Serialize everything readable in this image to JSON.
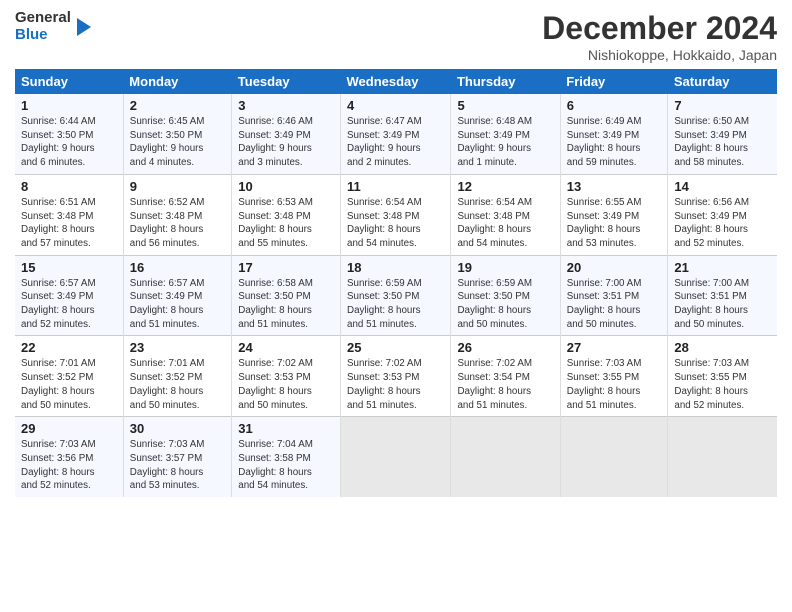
{
  "header": {
    "logo_general": "General",
    "logo_blue": "Blue",
    "title": "December 2024",
    "location": "Nishiokoppe, Hokkaido, Japan"
  },
  "weekdays": [
    "Sunday",
    "Monday",
    "Tuesday",
    "Wednesday",
    "Thursday",
    "Friday",
    "Saturday"
  ],
  "weeks": [
    [
      {
        "day": "1",
        "info": "Sunrise: 6:44 AM\nSunset: 3:50 PM\nDaylight: 9 hours\nand 6 minutes."
      },
      {
        "day": "2",
        "info": "Sunrise: 6:45 AM\nSunset: 3:50 PM\nDaylight: 9 hours\nand 4 minutes."
      },
      {
        "day": "3",
        "info": "Sunrise: 6:46 AM\nSunset: 3:49 PM\nDaylight: 9 hours\nand 3 minutes."
      },
      {
        "day": "4",
        "info": "Sunrise: 6:47 AM\nSunset: 3:49 PM\nDaylight: 9 hours\nand 2 minutes."
      },
      {
        "day": "5",
        "info": "Sunrise: 6:48 AM\nSunset: 3:49 PM\nDaylight: 9 hours\nand 1 minute."
      },
      {
        "day": "6",
        "info": "Sunrise: 6:49 AM\nSunset: 3:49 PM\nDaylight: 8 hours\nand 59 minutes."
      },
      {
        "day": "7",
        "info": "Sunrise: 6:50 AM\nSunset: 3:49 PM\nDaylight: 8 hours\nand 58 minutes."
      }
    ],
    [
      {
        "day": "8",
        "info": "Sunrise: 6:51 AM\nSunset: 3:48 PM\nDaylight: 8 hours\nand 57 minutes."
      },
      {
        "day": "9",
        "info": "Sunrise: 6:52 AM\nSunset: 3:48 PM\nDaylight: 8 hours\nand 56 minutes."
      },
      {
        "day": "10",
        "info": "Sunrise: 6:53 AM\nSunset: 3:48 PM\nDaylight: 8 hours\nand 55 minutes."
      },
      {
        "day": "11",
        "info": "Sunrise: 6:54 AM\nSunset: 3:48 PM\nDaylight: 8 hours\nand 54 minutes."
      },
      {
        "day": "12",
        "info": "Sunrise: 6:54 AM\nSunset: 3:48 PM\nDaylight: 8 hours\nand 54 minutes."
      },
      {
        "day": "13",
        "info": "Sunrise: 6:55 AM\nSunset: 3:49 PM\nDaylight: 8 hours\nand 53 minutes."
      },
      {
        "day": "14",
        "info": "Sunrise: 6:56 AM\nSunset: 3:49 PM\nDaylight: 8 hours\nand 52 minutes."
      }
    ],
    [
      {
        "day": "15",
        "info": "Sunrise: 6:57 AM\nSunset: 3:49 PM\nDaylight: 8 hours\nand 52 minutes."
      },
      {
        "day": "16",
        "info": "Sunrise: 6:57 AM\nSunset: 3:49 PM\nDaylight: 8 hours\nand 51 minutes."
      },
      {
        "day": "17",
        "info": "Sunrise: 6:58 AM\nSunset: 3:50 PM\nDaylight: 8 hours\nand 51 minutes."
      },
      {
        "day": "18",
        "info": "Sunrise: 6:59 AM\nSunset: 3:50 PM\nDaylight: 8 hours\nand 51 minutes."
      },
      {
        "day": "19",
        "info": "Sunrise: 6:59 AM\nSunset: 3:50 PM\nDaylight: 8 hours\nand 50 minutes."
      },
      {
        "day": "20",
        "info": "Sunrise: 7:00 AM\nSunset: 3:51 PM\nDaylight: 8 hours\nand 50 minutes."
      },
      {
        "day": "21",
        "info": "Sunrise: 7:00 AM\nSunset: 3:51 PM\nDaylight: 8 hours\nand 50 minutes."
      }
    ],
    [
      {
        "day": "22",
        "info": "Sunrise: 7:01 AM\nSunset: 3:52 PM\nDaylight: 8 hours\nand 50 minutes."
      },
      {
        "day": "23",
        "info": "Sunrise: 7:01 AM\nSunset: 3:52 PM\nDaylight: 8 hours\nand 50 minutes."
      },
      {
        "day": "24",
        "info": "Sunrise: 7:02 AM\nSunset: 3:53 PM\nDaylight: 8 hours\nand 50 minutes."
      },
      {
        "day": "25",
        "info": "Sunrise: 7:02 AM\nSunset: 3:53 PM\nDaylight: 8 hours\nand 51 minutes."
      },
      {
        "day": "26",
        "info": "Sunrise: 7:02 AM\nSunset: 3:54 PM\nDaylight: 8 hours\nand 51 minutes."
      },
      {
        "day": "27",
        "info": "Sunrise: 7:03 AM\nSunset: 3:55 PM\nDaylight: 8 hours\nand 51 minutes."
      },
      {
        "day": "28",
        "info": "Sunrise: 7:03 AM\nSunset: 3:55 PM\nDaylight: 8 hours\nand 52 minutes."
      }
    ],
    [
      {
        "day": "29",
        "info": "Sunrise: 7:03 AM\nSunset: 3:56 PM\nDaylight: 8 hours\nand 52 minutes."
      },
      {
        "day": "30",
        "info": "Sunrise: 7:03 AM\nSunset: 3:57 PM\nDaylight: 8 hours\nand 53 minutes."
      },
      {
        "day": "31",
        "info": "Sunrise: 7:04 AM\nSunset: 3:58 PM\nDaylight: 8 hours\nand 54 minutes."
      },
      {
        "day": "",
        "info": ""
      },
      {
        "day": "",
        "info": ""
      },
      {
        "day": "",
        "info": ""
      },
      {
        "day": "",
        "info": ""
      }
    ]
  ]
}
